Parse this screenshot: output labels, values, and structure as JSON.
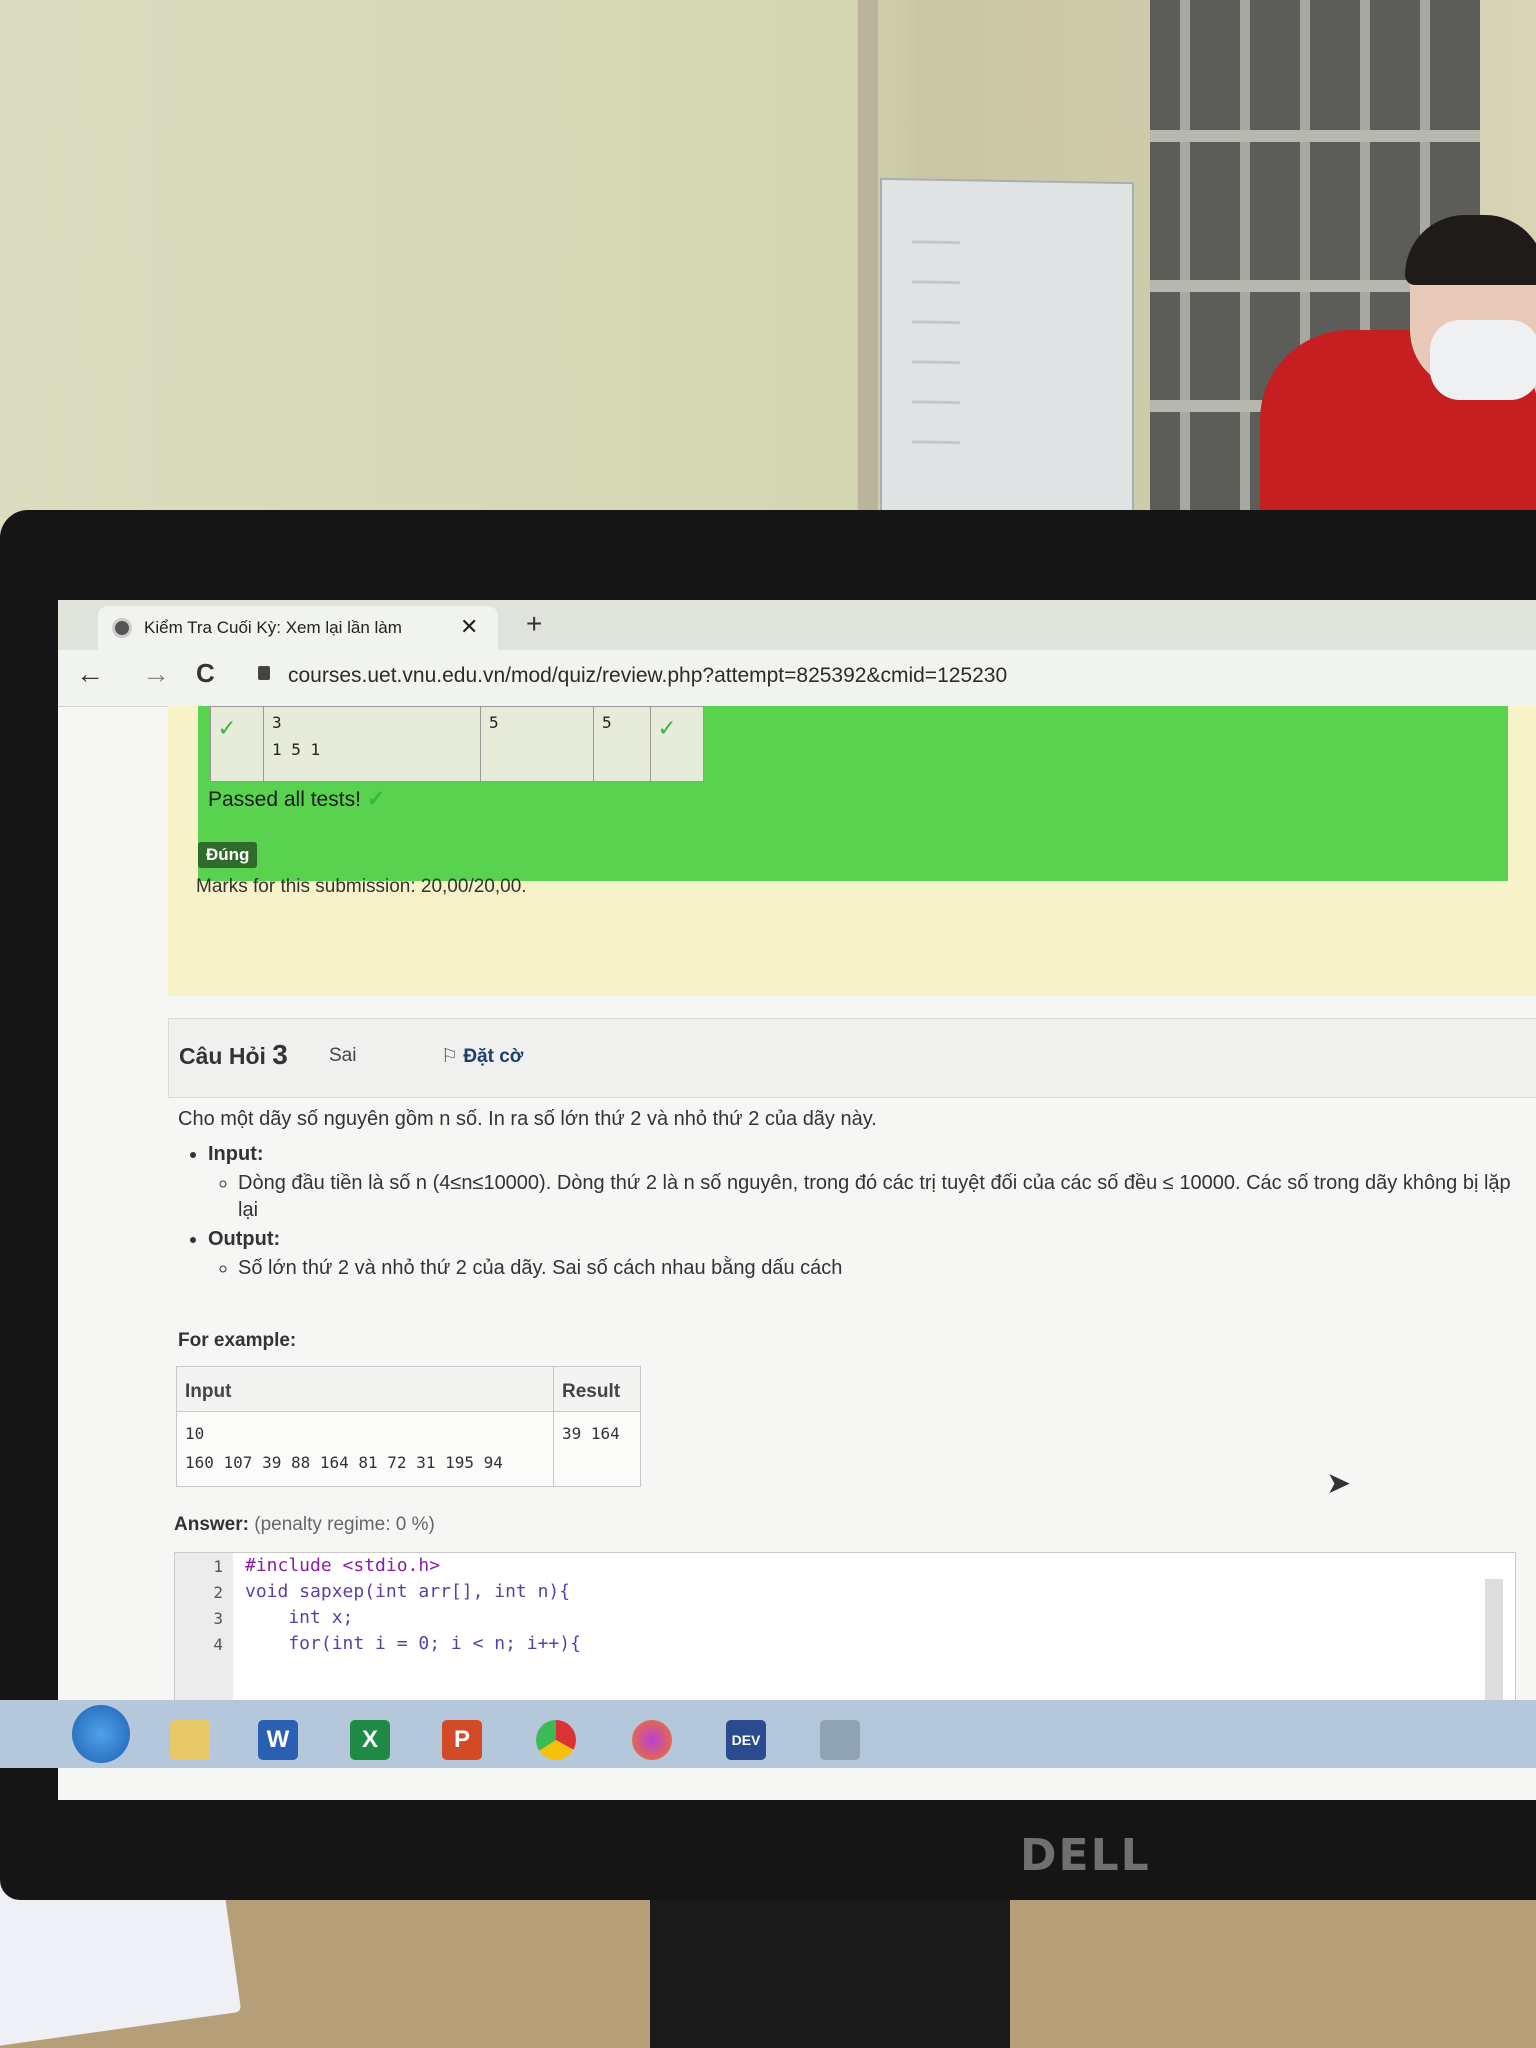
{
  "browser": {
    "tab_title": "Kiểm Tra Cuối Kỳ: Xem lại lần làm",
    "tab_close": "✕",
    "new_tab": "+",
    "back": "←",
    "forward": "→",
    "reload": "C",
    "url": "courses.uet.vnu.edu.vn/mod/quiz/review.php?attempt=825392&cmid=125230"
  },
  "prev_result": {
    "row_input_line1": "3",
    "row_input_line2": "1 5 1",
    "row_expected": "5",
    "row_got": "5",
    "row_check": "✓",
    "passed_text": "Passed all tests!",
    "passed_check": "✓",
    "status_badge": "Đúng",
    "marks": "Marks for this submission: 20,00/20,00."
  },
  "question": {
    "label": "Câu Hỏi",
    "number": "3",
    "state": "Sai",
    "flag_icon": "⚐",
    "flag_label": "Đặt cờ",
    "intro": "Cho một dãy số nguyên gồm n số. In ra số lớn thứ 2 và nhỏ thứ 2 của dãy này.",
    "input_heading": "Input:",
    "input_text": "Dòng đầu tiền là số n (4≤n≤10000). Dòng thứ 2 là n số nguyên, trong đó các trị tuyệt đối của các số đều ≤ 10000. Các số trong dãy không bị lặp lại",
    "output_heading": "Output:",
    "output_text": "Số lớn thứ 2 và nhỏ thứ 2 của dãy. Sai số cách nhau bằng dấu cách",
    "for_example": "For example:",
    "example": {
      "col_input": "Input",
      "col_result": "Result",
      "input_line1": "10",
      "input_line2": "160 107 39 88 164 81 72 31 195 94",
      "result": "39 164"
    },
    "answer_label": "Answer:",
    "penalty": "(penalty regime: 0 %)",
    "code_lines": [
      {
        "n": "1",
        "text": "#include <stdio.h>"
      },
      {
        "n": "2",
        "text": "void sapxep(int arr[], int n){"
      },
      {
        "n": "3",
        "text": "    int x;"
      },
      {
        "n": "4",
        "text": "    for(int i = 0; i < n; i++){"
      }
    ]
  },
  "taskbar": {
    "apps": [
      "start-orb",
      "file-explorer",
      "word",
      "excel",
      "powerpoint",
      "chrome",
      "firefox",
      "dev-cpp",
      "window"
    ],
    "word_letter": "W",
    "excel_letter": "X",
    "ppt_letter": "P",
    "dev_letter": "DEV"
  },
  "monitor_brand": "DELL"
}
